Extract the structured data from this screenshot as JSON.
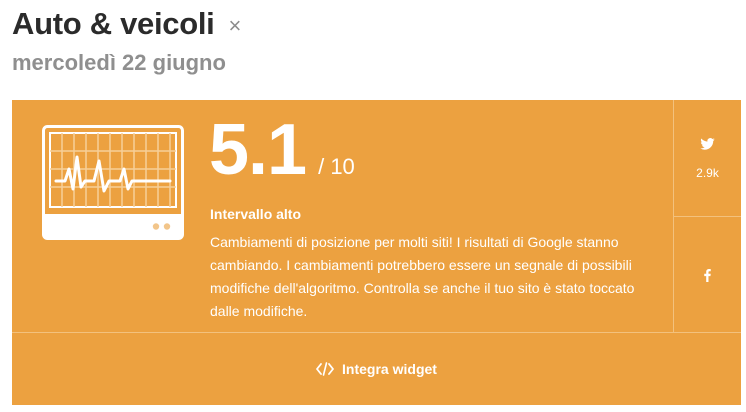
{
  "header": {
    "title": "Auto & veicoli",
    "close_symbol": "×",
    "date": "mercoledì 22 giugno"
  },
  "score": {
    "value": "5.1",
    "max": "/ 10",
    "range_label": "Intervallo alto",
    "description": "Cambiamenti di posizione per molti siti! I risultati di Google stanno cambiando. I cambiamenti potrebbero essere un segnale di possibili modifiche dell'algoritmo. Controlla se anche il tuo sito è stato toccato dalle modifiche."
  },
  "share": {
    "twitter_count": "2.9k",
    "twitter_icon": "twitter-icon",
    "facebook_icon": "facebook-icon"
  },
  "widget": {
    "label": "Integra widget",
    "icon": "code-icon"
  },
  "colors": {
    "card_background": "#eca140",
    "title": "#2b2b2b",
    "date": "#8f8f8f"
  }
}
